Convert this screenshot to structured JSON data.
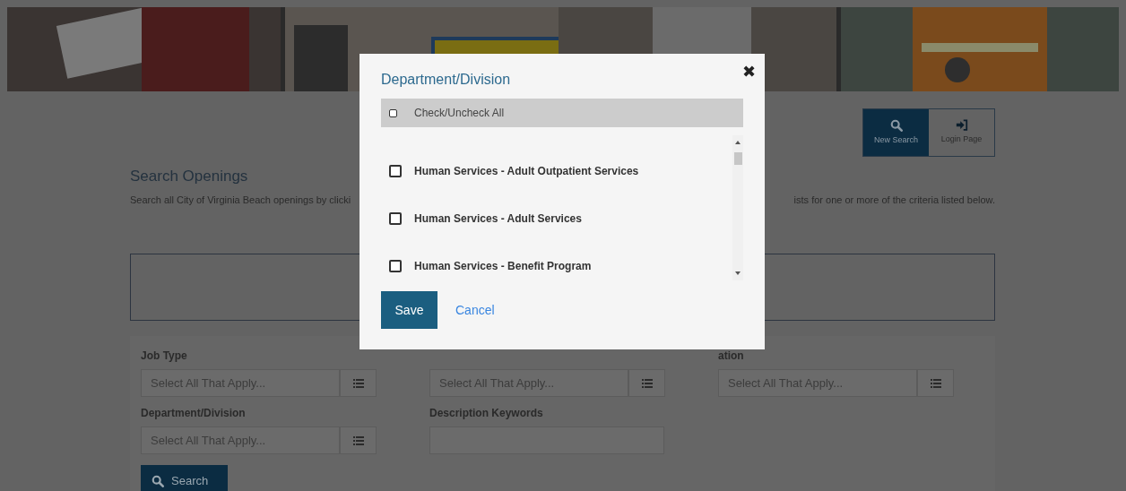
{
  "header_buttons": [
    {
      "kind": "search",
      "label": "New Search",
      "selected": true
    },
    {
      "kind": "login",
      "label": "Login Page",
      "selected": false
    }
  ],
  "heading": "Search Openings",
  "description_left": "Search all City of Virginia Beach openings by clicki",
  "description_right": "ists for one or more of the criteria listed below.",
  "filter_rows": [
    [
      {
        "kind": "select",
        "label": "Job Type",
        "placeholder": "Select All That Apply..."
      },
      {
        "kind": "select",
        "placeholder": "Select All That Apply..."
      },
      {
        "kind": "select",
        "label": "ation",
        "placeholder": "Select All That Apply..."
      }
    ],
    [
      {
        "kind": "select",
        "label": "Department/Division",
        "placeholder": "Select All That Apply..."
      },
      {
        "kind": "text",
        "label": "Description Keywords"
      }
    ]
  ],
  "search_button": "Search",
  "dialog": {
    "title": "Department/Division",
    "close": "✖",
    "check_all": {
      "label": "Check/Uncheck All",
      "checked": false
    },
    "items": [
      {
        "label": "Human Services - Adult Outpatient Services",
        "checked": false
      },
      {
        "label": "Human Services - Adult Services",
        "checked": false
      },
      {
        "label": "Human Services - Benefit Program",
        "checked": false
      }
    ],
    "save": "Save",
    "cancel": "Cancel"
  }
}
